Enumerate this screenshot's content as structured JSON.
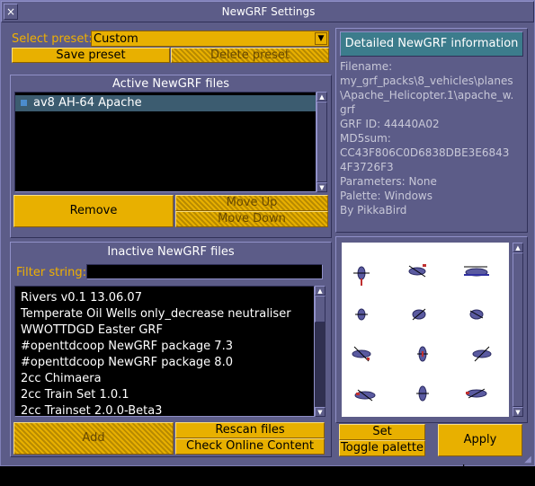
{
  "window": {
    "title": "NewGRF Settings",
    "close_glyph": "×"
  },
  "preset": {
    "label": "Select preset:",
    "value": "Custom",
    "save_label": "Save preset",
    "delete_label": "Delete preset"
  },
  "active": {
    "header": "Active NewGRF files",
    "items": [
      "av8 AH-64 Apache"
    ],
    "remove_label": "Remove",
    "move_up_label": "Move Up",
    "move_down_label": "Move Down"
  },
  "inactive": {
    "header": "Inactive NewGRF files",
    "filter_label": "Filter string:",
    "filter_value": "",
    "items": [
      "Rivers v0.1 13.06.07",
      "Temperate Oil Wells only_decrease neutraliser",
      "WWOTTDGD Easter GRF",
      "#openttdcoop NewGRF package 7.3",
      "#openttdcoop NewGRF package 8.0",
      "2cc Chimaera",
      "2cc Train Set 1.0.1",
      "2cc Trainset 2.0.0-Beta3"
    ],
    "add_label": "Add",
    "rescan_label": "Rescan files",
    "check_online_label": "Check Online Content"
  },
  "info": {
    "header": "Detailed NewGRF information",
    "lines": [
      "Filename:",
      "my_grf_packs\\8_vehicles\\planes",
      "\\Apache_Helicopter.1\\apache_w.",
      "grf",
      "GRF ID: 44440A02",
      "MD5sum:",
      "CC43F806C0D6838DBE3E6843",
      "4F3726F3",
      "Parameters: None",
      "Palette: Windows",
      "By PikkaBird"
    ]
  },
  "actions": {
    "set_parameters_label": "Set parameters",
    "toggle_palette_label": "Toggle palette",
    "apply_label": "Apply changes"
  },
  "colors": {
    "window": "#5c5c88",
    "button": "#e8b000",
    "info_header": "#3c7c8c",
    "label_orange": "#f0b000",
    "selection": "#3c5c70"
  }
}
